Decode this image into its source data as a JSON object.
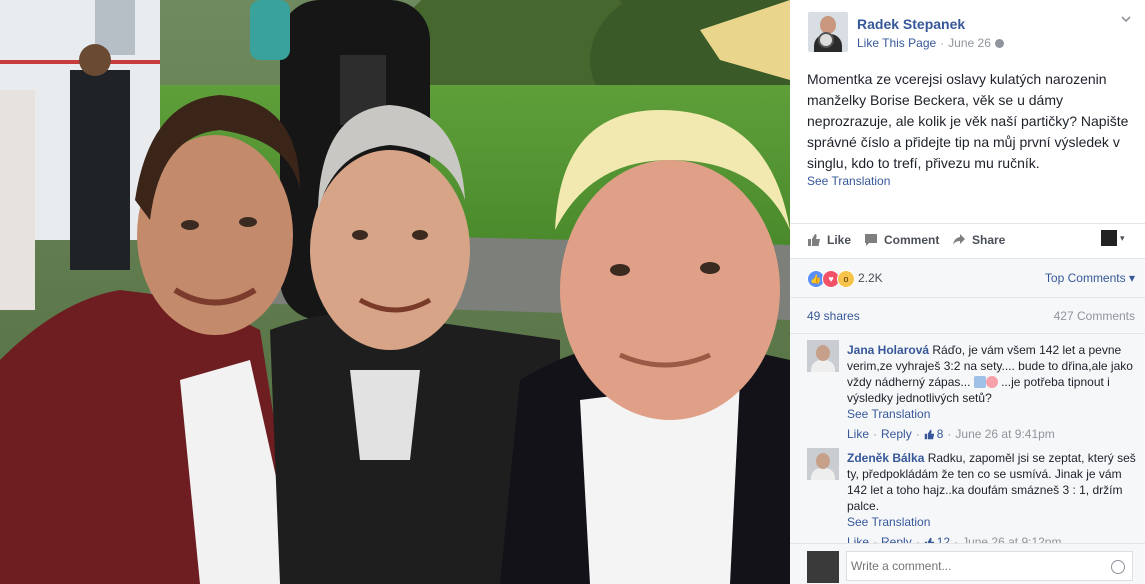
{
  "post": {
    "author": "Radek Stepanek",
    "like_page": "Like This Page",
    "separator": "·",
    "date": "June 26",
    "text": "Momentka ze vcerejsi oslavy kulatých narozenin manželky Borise Beckera, věk se u dámy neprozrazuje, ale kolik je věk naší partičky? Napište správné číslo a přidejte tip na můj první výsledek v singlu, kdo to trefí, přivezu mu ručník.",
    "see_translation": "See Translation",
    "menu_icon": "chevron-down-icon"
  },
  "actions": {
    "like": "Like",
    "comment": "Comment",
    "share": "Share"
  },
  "reactions": {
    "count": "2.2K",
    "top_comments": "Top Comments",
    "caret": "▾"
  },
  "stats": {
    "shares": "49 shares",
    "comments": "427 Comments"
  },
  "comments": [
    {
      "name": "Jana Holarová",
      "text": "Ráďo, je vám všem 142 let a pevne verim,ze vyhraješ 3:2 na sety.... bude to dřina,ale jako vždy nádherný zápas...",
      "text_after": "...je potřeba tipnout i výsledky jednotlivých setů?",
      "see_translation": "See Translation",
      "like": "Like",
      "reply": "Reply",
      "likes": "8",
      "time": "June 26 at 9:41pm"
    },
    {
      "name": "Zdeněk Bálka",
      "text": "Radku, zapoměl jsi se zeptat, který seš ty, předpokládám že ten co se usmívá. Jinak je vám 142 let a toho hajz..ka doufám smázneš 3 : 1, držím palce.",
      "see_translation": "See Translation",
      "like": "Like",
      "reply": "Reply",
      "likes": "12",
      "time": "June 26 at 9:12pm"
    }
  ],
  "write": {
    "placeholder": "Write a comment..."
  },
  "colors": {
    "link": "#365899",
    "muted": "#90949c",
    "panel_bg": "#f6f7f9"
  }
}
